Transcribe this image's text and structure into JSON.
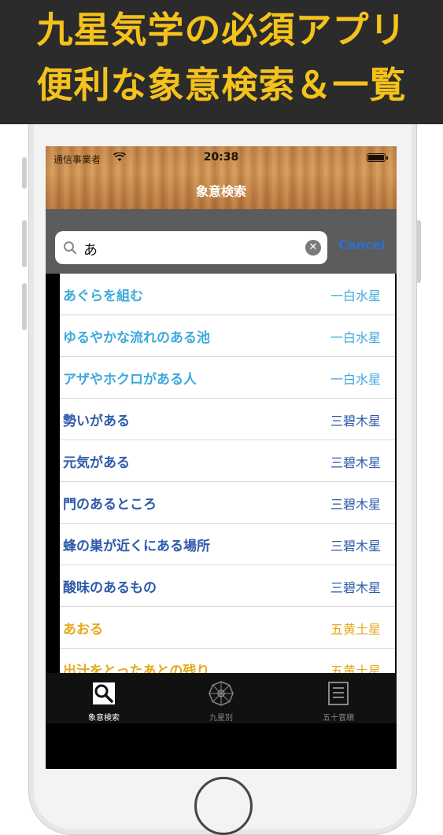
{
  "banner": {
    "line1": "九星気学の必須アプリ",
    "line2": "便利な象意検索＆一覧"
  },
  "status": {
    "carrier": "通信事業者",
    "time": "20:38"
  },
  "nav": {
    "title": "象意検索"
  },
  "search": {
    "value": "あ",
    "cancel_label": "Cancel"
  },
  "colors": {
    "ichihaku": "#3fa9dc",
    "sanpeki": "#2f5aaa",
    "gooh": "#e6a81c"
  },
  "results": [
    {
      "term": "あぐらを組む",
      "star": "一白水星",
      "color": "#3fa9dc"
    },
    {
      "term": "ゆるやかな流れのある池",
      "star": "一白水星",
      "color": "#3fa9dc"
    },
    {
      "term": "アザやホクロがある人",
      "star": "一白水星",
      "color": "#3fa9dc"
    },
    {
      "term": "勢いがある",
      "star": "三碧木星",
      "color": "#2f5aaa"
    },
    {
      "term": "元気がある",
      "star": "三碧木星",
      "color": "#2f5aaa"
    },
    {
      "term": "門のあるところ",
      "star": "三碧木星",
      "color": "#2f5aaa"
    },
    {
      "term": "蜂の巣が近くにある場所",
      "star": "三碧木星",
      "color": "#2f5aaa"
    },
    {
      "term": "酸味のあるもの",
      "star": "三碧木星",
      "color": "#2f5aaa"
    },
    {
      "term": "あおる",
      "star": "五黄土星",
      "color": "#e6a81c"
    },
    {
      "term": "出汁をとったあとの残り",
      "star": "五黄土星",
      "color": "#e6a81c"
    }
  ],
  "tabs": [
    {
      "label": "象意検索",
      "icon": "search-icon",
      "active": true
    },
    {
      "label": "九星別",
      "icon": "kyusei-wheel-icon",
      "active": false
    },
    {
      "label": "五十音順",
      "icon": "list-icon",
      "active": false
    }
  ]
}
